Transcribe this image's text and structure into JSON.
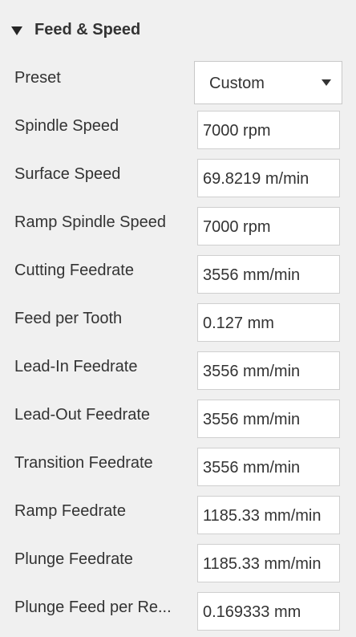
{
  "section": {
    "title": "Feed & Speed",
    "icon": "collapse-triangle-icon"
  },
  "preset": {
    "label": "Preset",
    "value": "Custom",
    "icon": "chevron-down-icon"
  },
  "fields": [
    {
      "label": "Spindle Speed",
      "value": "7000 rpm"
    },
    {
      "label": "Surface Speed",
      "value": "69.8219 m/min"
    },
    {
      "label": "Ramp Spindle Speed",
      "value": "7000 rpm"
    },
    {
      "label": "Cutting Feedrate",
      "value": "3556 mm/min"
    },
    {
      "label": "Feed per Tooth",
      "value": "0.127 mm"
    },
    {
      "label": "Lead-In Feedrate",
      "value": "3556 mm/min"
    },
    {
      "label": "Lead-Out Feedrate",
      "value": "3556 mm/min"
    },
    {
      "label": "Transition Feedrate",
      "value": "3556 mm/min"
    },
    {
      "label": "Ramp Feedrate",
      "value": "1185.33 mm/min"
    },
    {
      "label": "Plunge Feedrate",
      "value": "1185.33 mm/min"
    },
    {
      "label": "Plunge Feed per Re...",
      "value": "0.169333 mm"
    }
  ]
}
